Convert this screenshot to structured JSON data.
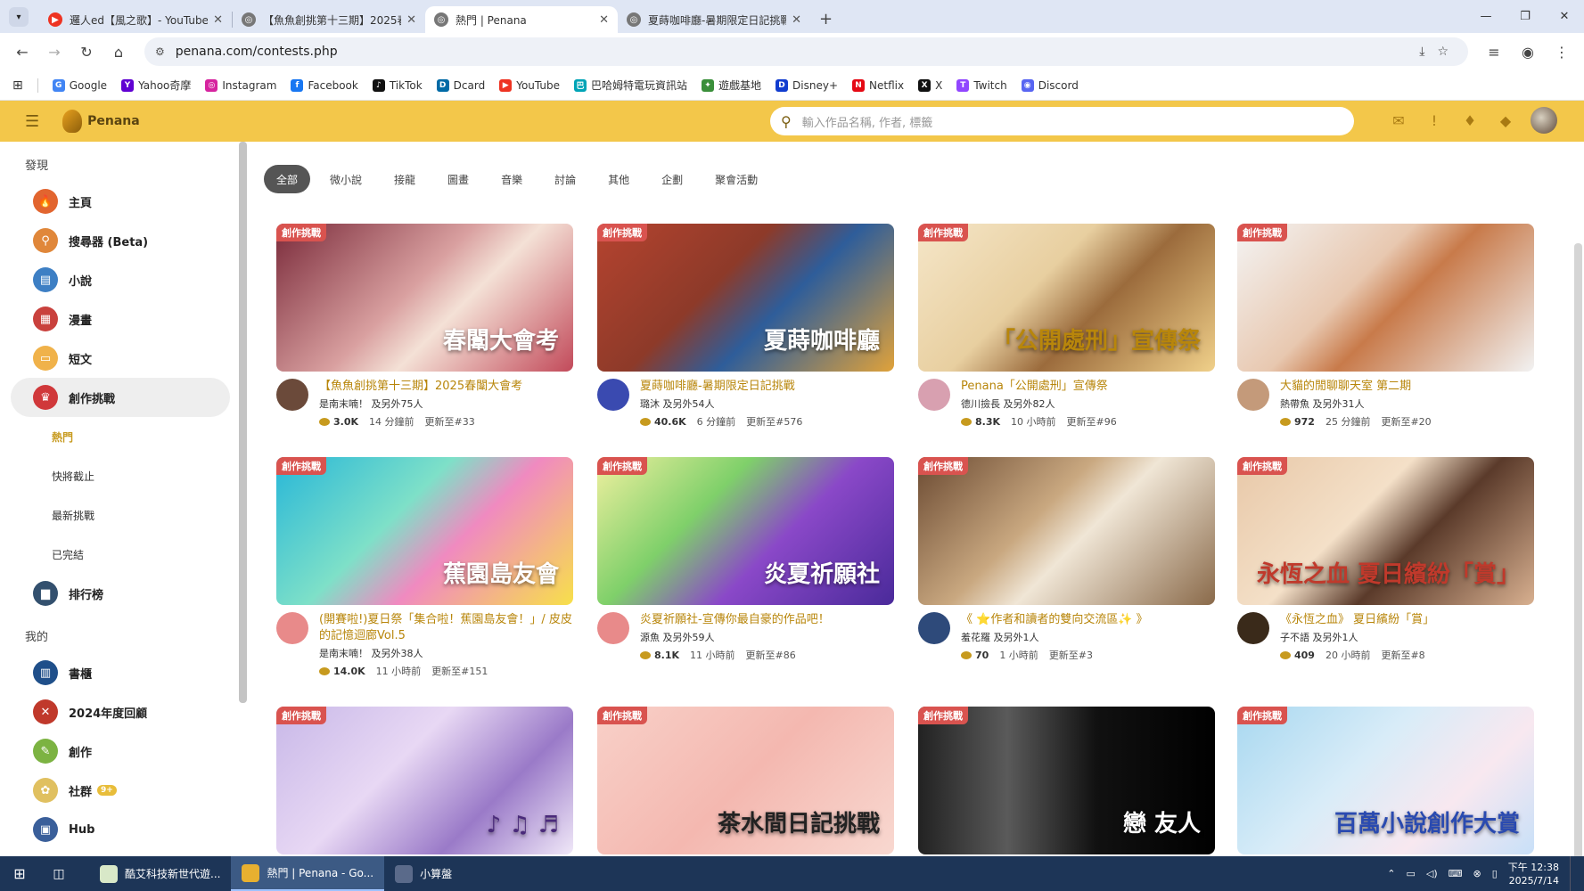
{
  "browser": {
    "tabs": [
      {
        "title": "邏人ed【風之歌】- YouTube",
        "active": false,
        "icon": "youtube-icon",
        "color": "#e32"
      },
      {
        "title": "【魚魚創挑第十三期】2025春闈",
        "active": false,
        "icon": "globe-icon",
        "color": "#777"
      },
      {
        "title": "熱門 | Penana",
        "active": true,
        "icon": "globe-icon",
        "color": "#777"
      },
      {
        "title": "夏蒔咖啡廳-暑期限定日記挑戰",
        "active": false,
        "icon": "globe-icon",
        "color": "#777"
      }
    ],
    "url": "penana.com/contests.php",
    "bookmarks": [
      {
        "label": "Google",
        "color": "#4285f4",
        "glyph": "G"
      },
      {
        "label": "Yahoo奇摩",
        "color": "#6001d2",
        "glyph": "Y"
      },
      {
        "label": "Instagram",
        "color": "#d6249f",
        "glyph": "◎"
      },
      {
        "label": "Facebook",
        "color": "#1877f2",
        "glyph": "f"
      },
      {
        "label": "TikTok",
        "color": "#111",
        "glyph": "♪"
      },
      {
        "label": "Dcard",
        "color": "#006aa6",
        "glyph": "D"
      },
      {
        "label": "YouTube",
        "color": "#e32",
        "glyph": "▶"
      },
      {
        "label": "巴哈姆特電玩資訊站",
        "color": "#00a4b6",
        "glyph": "巴"
      },
      {
        "label": "遊戲基地",
        "color": "#3a8f3a",
        "glyph": "✦"
      },
      {
        "label": "Disney+",
        "color": "#113ccf",
        "glyph": "D"
      },
      {
        "label": "Netflix",
        "color": "#e50914",
        "glyph": "N"
      },
      {
        "label": "X",
        "color": "#111",
        "glyph": "X"
      },
      {
        "label": "Twitch",
        "color": "#9146ff",
        "glyph": "T"
      },
      {
        "label": "Discord",
        "color": "#5865f2",
        "glyph": "◉"
      }
    ]
  },
  "site": {
    "logo_text": "Penana",
    "search_placeholder": "輸入作品名稱, 作者, 標籤"
  },
  "sidebar": {
    "discover_label": "發現",
    "items": [
      {
        "label": "主頁",
        "icon": "fire-icon",
        "color": "#e2652f",
        "glyph": "🔥"
      },
      {
        "label": "搜尋器 (Beta)",
        "icon": "search-icon",
        "color": "#e0873a",
        "glyph": "⚲"
      },
      {
        "label": "小說",
        "icon": "book-icon",
        "color": "#3d7fc4",
        "glyph": "▤"
      },
      {
        "label": "漫畫",
        "icon": "comic-icon",
        "color": "#c9413d",
        "glyph": "▦"
      },
      {
        "label": "短文",
        "icon": "note-icon",
        "color": "#f0b24a",
        "glyph": "▭"
      },
      {
        "label": "創作挑戰",
        "icon": "trophy-icon",
        "color": "#d0383a",
        "glyph": "♛"
      }
    ],
    "sub_items": [
      {
        "label": "熱門",
        "active": true
      },
      {
        "label": "快將截止",
        "active": false
      },
      {
        "label": "最新挑戰",
        "active": false
      },
      {
        "label": "已完結",
        "active": false
      }
    ],
    "ranking_label": "排行榜",
    "mine_label": "我的",
    "mine_items": [
      {
        "label": "書櫃",
        "icon": "bookshelf-icon",
        "color": "#1f4f8a",
        "glyph": "▥"
      },
      {
        "label": "2024年度回顧",
        "icon": "review-icon",
        "color": "#c0392b",
        "glyph": "✕"
      },
      {
        "label": "創作",
        "icon": "pen-icon",
        "color": "#7cb342",
        "glyph": "✎"
      },
      {
        "label": "社群",
        "icon": "community-icon",
        "color": "#e0c060",
        "glyph": "✿",
        "badge": "9+"
      },
      {
        "label": "Hub",
        "icon": "hub-icon",
        "color": "#3a5f9a",
        "glyph": "▣"
      }
    ]
  },
  "categories": [
    {
      "label": "全部",
      "active": true
    },
    {
      "label": "微小說",
      "active": false
    },
    {
      "label": "接龍",
      "active": false
    },
    {
      "label": "圖畫",
      "active": false
    },
    {
      "label": "音樂",
      "active": false
    },
    {
      "label": "討論",
      "active": false
    },
    {
      "label": "其他",
      "active": false
    },
    {
      "label": "企劃",
      "active": false
    },
    {
      "label": "聚會活動",
      "active": false
    }
  ],
  "tag_label": "創作挑戰",
  "cards": [
    {
      "title": "【魚魚創挑第十三期】2025春闈大會考",
      "author": "是南末喃！ 及另外75人",
      "views": "3.0K",
      "time": "14 分鐘前",
      "update": "更新至#33",
      "bg": "linear-gradient(135deg,#7a2a3a,#d9a0a0 45%,#f4e1d6 60%,#c24a5a)",
      "avatar": "#6b4a3a",
      "overlay": "春闈大會考",
      "overlay_color": "#fff"
    },
    {
      "title": "夏蒔咖啡廳-暑期限定日記挑戰",
      "author": "璐沐 及另外54人",
      "views": "40.6K",
      "time": "6 分鐘前",
      "update": "更新至#576",
      "bg": "linear-gradient(135deg,#b5432f,#8d3a29 40%,#2e5d9a 60%,#e0a23a)",
      "avatar": "#3a4ab0",
      "overlay": "夏蒔咖啡廳",
      "overlay_color": "#fff"
    },
    {
      "title": "Penana「公開處刑」宣傳祭",
      "author": "德川撿長 及另外82人",
      "views": "8.3K",
      "time": "10 小時前",
      "update": "更新至#96",
      "bg": "linear-gradient(135deg,#f5e6c8,#e8cfa0 40%,#9b6b3c 60%,#f0d08a)",
      "avatar": "#d8a0b0",
      "overlay": "「公開處刑」宣傳祭",
      "overlay_color": "#b8860b"
    },
    {
      "title": "大貓的閒聊聊天室 第二期",
      "author": "熱帶魚 及另外31人",
      "views": "972",
      "time": "25 分鐘前",
      "update": "更新至#20",
      "bg": "linear-gradient(135deg,#f4f4f4,#e8c8b0 40%,#c87a4a 55%,#f2f2f2)",
      "avatar": "#c49a7a",
      "overlay": "",
      "overlay_color": "#fff"
    },
    {
      "title": "(開賽啦!)夏日祭「集合啦！蕉園島友會！」/ 皮皮的記憶迴廊Vol.5",
      "author": "是南末喃！ 及另外38人",
      "views": "14.0K",
      "time": "11 小時前",
      "update": "更新至#151",
      "bg": "linear-gradient(135deg,#28b7d8,#7ee0c8 40%,#f08ac0 60%,#f7e04a)",
      "avatar": "#e88a8a",
      "overlay": "蕉園島友會",
      "overlay_color": "#fff"
    },
    {
      "title": "炎夏祈願社-宣傳你最自豪的作品吧！",
      "author": "源魚 及另外59人",
      "views": "8.1K",
      "time": "11 小時前",
      "update": "更新至#86",
      "bg": "linear-gradient(135deg,#f0f0a0,#7fd06a 35%,#8a48c8 60%,#4a2a9a)",
      "avatar": "#e88a8a",
      "overlay": "炎夏祈願社",
      "overlay_color": "#fff"
    },
    {
      "title": "《 ⭐作者和讀者的雙向交流區✨ 》",
      "author": "羞花羅 及另外1人",
      "views": "70",
      "time": "1 小時前",
      "update": "更新至#3",
      "bg": "linear-gradient(135deg,#6b4a32,#c9a880 40%,#f0e6d6 55%,#8a6a4a)",
      "avatar": "#2e4a7a",
      "overlay": "",
      "overlay_color": "#fff"
    },
    {
      "title": "《永恆之血》 夏日繽紛「賞」",
      "author": "子不語 及另外1人",
      "views": "409",
      "time": "20 小時前",
      "update": "更新至#8",
      "bg": "linear-gradient(135deg,#e8c8a8,#f4e0c8 40%,#5a3a2a 60%,#d8b090)",
      "avatar": "#3a2a1a",
      "overlay": "永恆之血 夏日繽紛「賞」",
      "overlay_color": "#c0392b"
    },
    {
      "title": "",
      "author": "",
      "views": "",
      "time": "",
      "update": "",
      "bg": "linear-gradient(135deg,#c8b8e8,#e8d8f4 40%,#9a7ac8 70%,#f0e8f8)",
      "avatar": "#fff",
      "overlay": "♪ ♫ ♬",
      "overlay_color": "#4a2a7a"
    },
    {
      "title": "",
      "author": "",
      "views": "",
      "time": "",
      "update": "",
      "bg": "linear-gradient(135deg,#f8d0c8,#f4b8b0 50%,#f8d8d0)",
      "avatar": "#fff",
      "overlay": "茶水間日記挑戰",
      "overlay_color": "#222"
    },
    {
      "title": "",
      "author": "",
      "views": "",
      "time": "",
      "update": "",
      "bg": "linear-gradient(90deg,#222,#5a5a5a 30%,#111 60%,#000)",
      "avatar": "#fff",
      "overlay": "戀 友人",
      "overlay_color": "#fff"
    },
    {
      "title": "",
      "author": "",
      "views": "",
      "time": "",
      "update": "",
      "bg": "linear-gradient(135deg,#a8d8f0,#d8ecf8 40%,#f8e8f0 70%,#c8e0f8)",
      "avatar": "#fff",
      "overlay": "百萬小說創作大賞",
      "overlay_color": "#2a4ab0"
    }
  ],
  "taskbar": {
    "apps": [
      {
        "label": "酷艾科技新世代遊...",
        "icon": "app-icon",
        "color": "#d8e8c8",
        "active": false
      },
      {
        "label": "熱門 | Penana - Go...",
        "icon": "chrome-icon",
        "color": "#e8b030",
        "active": true
      },
      {
        "label": "小算盤",
        "icon": "calculator-icon",
        "color": "#5a6a8a",
        "active": false
      }
    ],
    "time": "下午 12:38",
    "date": "2025/7/14"
  }
}
